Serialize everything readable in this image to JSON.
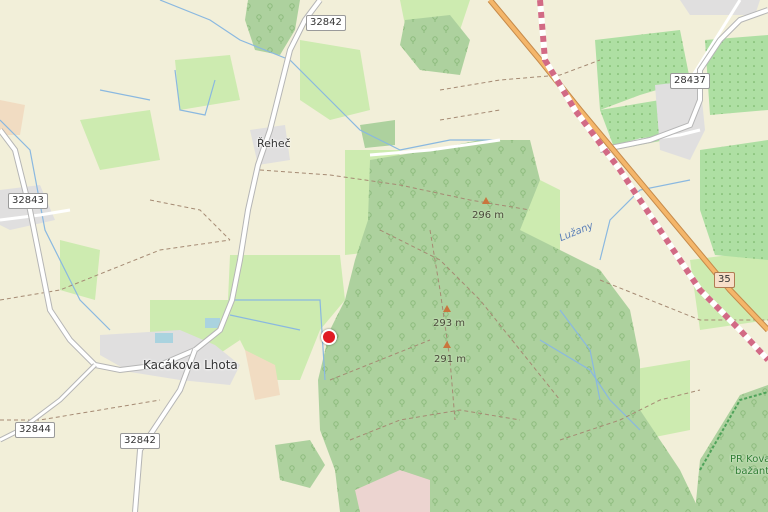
{
  "places": {
    "village_main": "Kacákova Lhota",
    "village_north": "Řeheč",
    "hamlet_east": "Lužany",
    "reserve_label_1": "PR Kovac",
    "reserve_label_2": "bažantn"
  },
  "roads": {
    "r32842_north": "32842",
    "r32842_south": "32842",
    "r32843": "32843",
    "r32844": "32844",
    "r28437": "28437",
    "r35": "35"
  },
  "peaks": {
    "peak_1": "296 m",
    "peak_2": "293 m",
    "peak_3": "291 m"
  },
  "colors": {
    "background": "#f2efd9",
    "forest": "#add19e",
    "meadow": "#cdebb0",
    "water": "#aad3df",
    "stream": "#5b9bd5",
    "residential": "#e0dfdf",
    "railway": "#d26a85",
    "primary_road": "#f4b66a",
    "path": "#a58a73",
    "marker": "#e01b24"
  },
  "marker": {
    "icon": "location-marker-icon"
  }
}
